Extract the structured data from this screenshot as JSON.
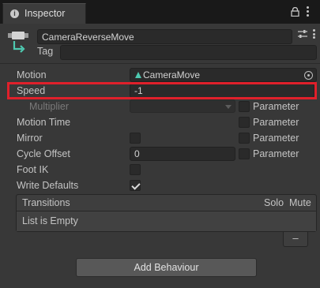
{
  "window": {
    "tab_label": "Inspector",
    "tab_icon": "info-icon"
  },
  "header": {
    "name_value": "CameraReverseMove",
    "tag_label": "Tag",
    "tag_value": ""
  },
  "fields": {
    "motion_label": "Motion",
    "motion_value": "CameraMove",
    "speed_label": "Speed",
    "speed_value": "-1",
    "multiplier_label": "Multiplier",
    "multiplier_value": "",
    "motion_time_label": "Motion Time",
    "mirror_label": "Mirror",
    "cycle_offset_label": "Cycle Offset",
    "cycle_offset_value": "0",
    "foot_ik_label": "Foot IK",
    "write_defaults_label": "Write Defaults",
    "parameter_label": "Parameter"
  },
  "checkbox_states": {
    "multiplier_parameter": false,
    "motion_time_parameter": false,
    "mirror": false,
    "mirror_parameter": false,
    "cycle_offset_parameter": false,
    "foot_ik": false,
    "write_defaults": true
  },
  "transitions": {
    "title": "Transitions",
    "solo_label": "Solo",
    "mute_label": "Mute",
    "empty_text": "List is Empty",
    "remove_label": "–"
  },
  "add_behaviour_label": "Add Behaviour",
  "colors": {
    "background": "#383838",
    "tab_bar": "#191919",
    "highlight": "#e0202b",
    "motion_icon": "#4ec9b0"
  }
}
